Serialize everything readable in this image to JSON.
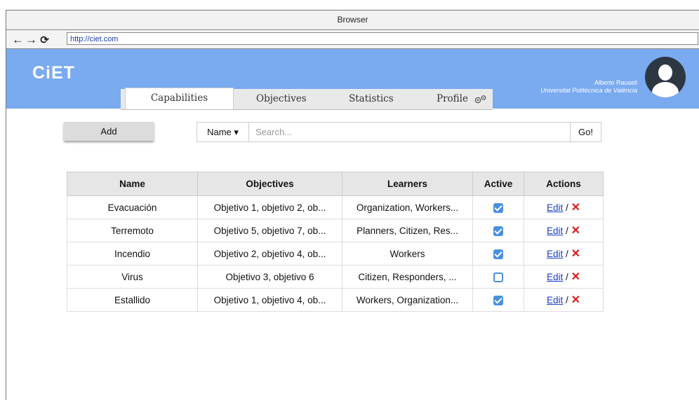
{
  "browser": {
    "title": "Browser",
    "url": "http://ciet.com"
  },
  "app": {
    "logo": "CiET",
    "tabs": [
      "Capabilities",
      "Objectives",
      "Statistics",
      "Profile"
    ],
    "user": {
      "name": "Alberto Rausell",
      "institution": "Universitat Politècnica de València"
    }
  },
  "toolbar": {
    "add_label": "Add",
    "filter_label": "Name ▾",
    "search_placeholder": "Search...",
    "go_label": "Go!"
  },
  "table": {
    "headers": [
      "Name",
      "Objectives",
      "Learners",
      "Active",
      "Actions"
    ],
    "rows": [
      {
        "name": "Evacuación",
        "objectives": "Objetivo 1, objetivo 2, ob...",
        "learners": "Organization, Workers...",
        "active": true
      },
      {
        "name": "Terremoto",
        "objectives": "Objetivo 5, objetivo 7, ob...",
        "learners": "Planners, Citizen, Res...",
        "active": true
      },
      {
        "name": "Incendio",
        "objectives": "Objetivo 2, objetivo 4, ob...",
        "learners": "Workers",
        "active": true
      },
      {
        "name": "Virus",
        "objectives": "Objetivo 3, objetivo 6",
        "learners": "Citizen, Responders, ...",
        "active": false
      },
      {
        "name": "Estallido",
        "objectives": "Objetivo 1, objetivo 4, ob...",
        "learners": "Workers, Organization...",
        "active": true
      }
    ],
    "edit_label": "Edit",
    "separator": "/"
  },
  "colors": {
    "header_bg": "#7aaaf0",
    "checkbox": "#4a90e2",
    "delete": "#e01b1b",
    "link": "#1a3dc8"
  }
}
